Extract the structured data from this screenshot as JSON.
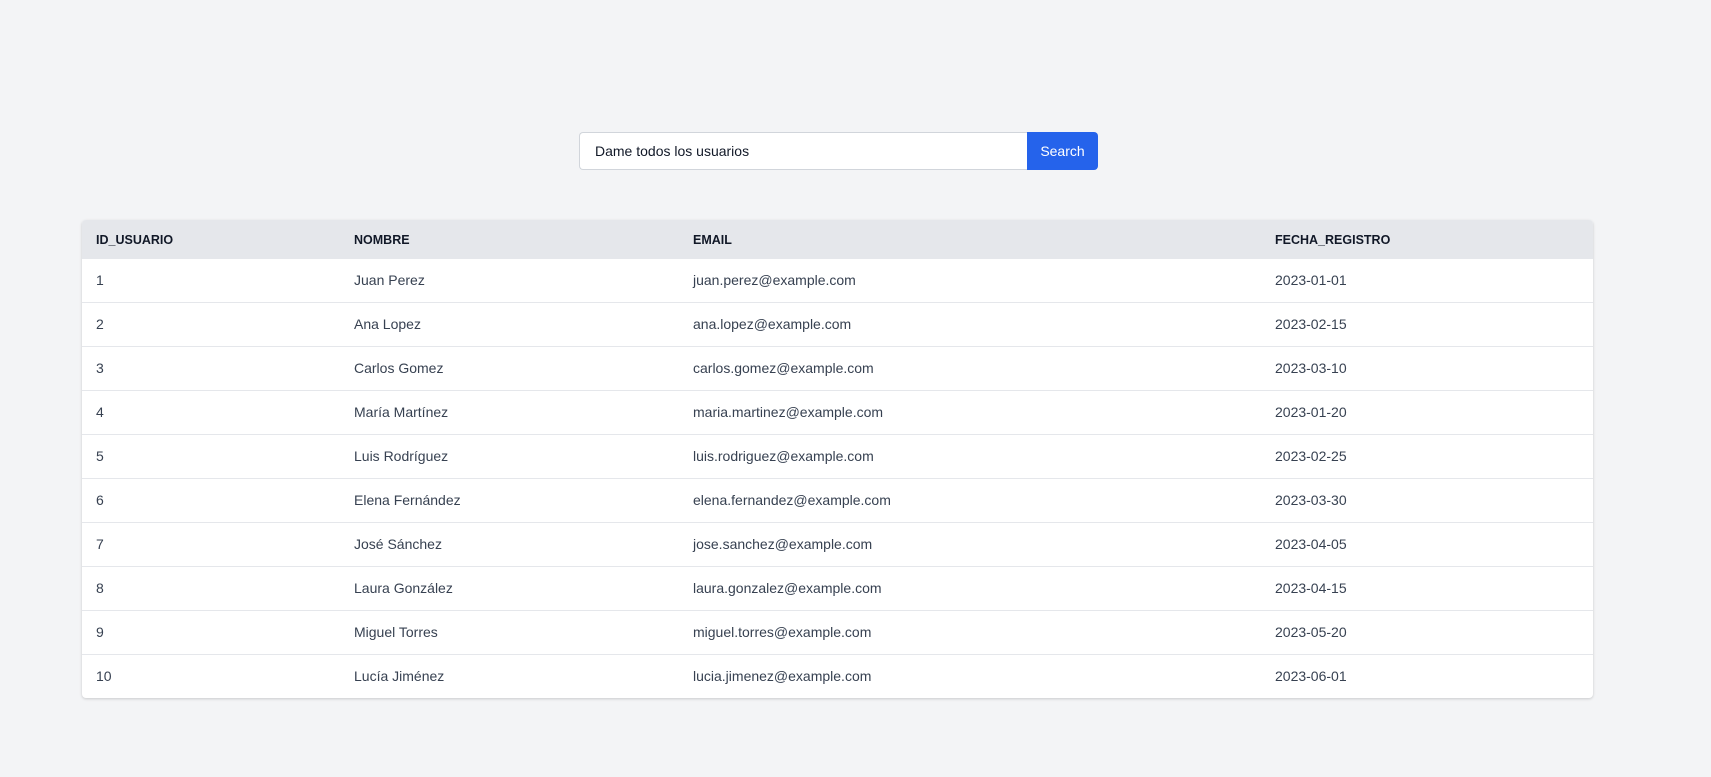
{
  "search": {
    "value": "Dame todos los usuarios",
    "button_label": "Search"
  },
  "table": {
    "columns": [
      "ID_USUARIO",
      "NOMBRE",
      "EMAIL",
      "FECHA_REGISTRO"
    ],
    "rows": [
      [
        "1",
        "Juan Perez",
        "juan.perez@example.com",
        "2023-01-01"
      ],
      [
        "2",
        "Ana Lopez",
        "ana.lopez@example.com",
        "2023-02-15"
      ],
      [
        "3",
        "Carlos Gomez",
        "carlos.gomez@example.com",
        "2023-03-10"
      ],
      [
        "4",
        "María Martínez",
        "maria.martinez@example.com",
        "2023-01-20"
      ],
      [
        "5",
        "Luis Rodríguez",
        "luis.rodriguez@example.com",
        "2023-02-25"
      ],
      [
        "6",
        "Elena Fernández",
        "elena.fernandez@example.com",
        "2023-03-30"
      ],
      [
        "7",
        "José Sánchez",
        "jose.sanchez@example.com",
        "2023-04-05"
      ],
      [
        "8",
        "Laura González",
        "laura.gonzalez@example.com",
        "2023-04-15"
      ],
      [
        "9",
        "Miguel Torres",
        "miguel.torres@example.com",
        "2023-05-20"
      ],
      [
        "10",
        "Lucía Jiménez",
        "lucia.jimenez@example.com",
        "2023-06-01"
      ]
    ]
  },
  "colors": {
    "background": "#f3f4f6",
    "accent": "#2563eb",
    "header_bg": "#e5e7eb"
  }
}
